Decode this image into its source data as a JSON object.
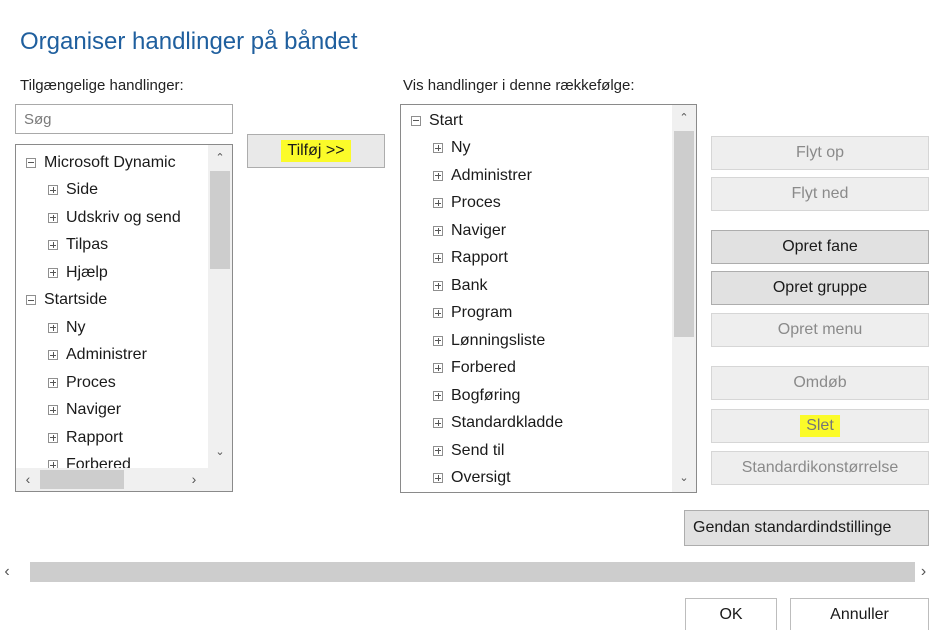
{
  "dialog": {
    "title": "Organiser handlinger på båndet",
    "available_label": "Tilgængelige handlinger:",
    "order_label": "Vis handlinger i denne rækkefølge:"
  },
  "search": {
    "placeholder": "Søg"
  },
  "add_button": {
    "label": "Tilføj >>"
  },
  "available_tree": [
    {
      "label": "Microsoft Dynamic",
      "expanded": true,
      "level": 0
    },
    {
      "label": "Side",
      "expanded": false,
      "level": 1
    },
    {
      "label": "Udskriv og send",
      "expanded": false,
      "level": 1
    },
    {
      "label": "Tilpas",
      "expanded": false,
      "level": 1
    },
    {
      "label": "Hjælp",
      "expanded": false,
      "level": 1
    },
    {
      "label": "Startside",
      "expanded": true,
      "level": 0
    },
    {
      "label": "Ny",
      "expanded": false,
      "level": 1
    },
    {
      "label": "Administrer",
      "expanded": false,
      "level": 1
    },
    {
      "label": "Proces",
      "expanded": false,
      "level": 1
    },
    {
      "label": "Naviger",
      "expanded": false,
      "level": 1
    },
    {
      "label": "Rapport",
      "expanded": false,
      "level": 1
    },
    {
      "label": "Forbered",
      "expanded": false,
      "level": 1
    }
  ],
  "order_tree": [
    {
      "label": "Start",
      "expanded": true,
      "level": 0
    },
    {
      "label": "Ny",
      "expanded": false,
      "level": 1
    },
    {
      "label": "Administrer",
      "expanded": false,
      "level": 1
    },
    {
      "label": "Proces",
      "expanded": false,
      "level": 1
    },
    {
      "label": "Naviger",
      "expanded": false,
      "level": 1
    },
    {
      "label": "Rapport",
      "expanded": false,
      "level": 1
    },
    {
      "label": "Bank",
      "expanded": false,
      "level": 1
    },
    {
      "label": "Program",
      "expanded": false,
      "level": 1
    },
    {
      "label": "Lønningsliste",
      "expanded": false,
      "level": 1
    },
    {
      "label": "Forbered",
      "expanded": false,
      "level": 1
    },
    {
      "label": "Bogføring",
      "expanded": false,
      "level": 1
    },
    {
      "label": "Standardkladde",
      "expanded": false,
      "level": 1
    },
    {
      "label": "Send til",
      "expanded": false,
      "level": 1
    },
    {
      "label": "Oversigt",
      "expanded": false,
      "level": 1
    }
  ],
  "side_buttons": {
    "move_up": "Flyt op",
    "move_down": "Flyt ned",
    "create_tab": "Opret fane",
    "create_group": "Opret gruppe",
    "create_menu": "Opret menu",
    "rename": "Omdøb",
    "delete": "Slet",
    "default_icon_size": "Standardikonstørrelse"
  },
  "restore_defaults": "Gendan standardindstillinge",
  "footer": {
    "ok": "OK",
    "cancel": "Annuller"
  },
  "colors": {
    "title": "#1f5f9e",
    "highlight": "#fbfb29"
  }
}
